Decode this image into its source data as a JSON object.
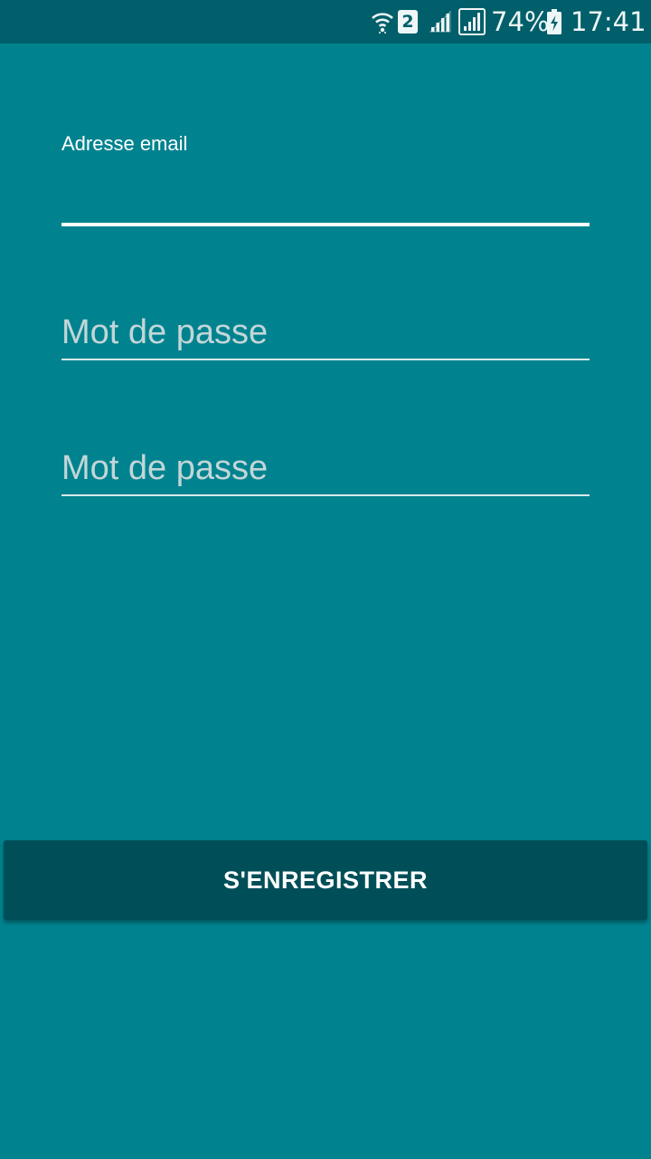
{
  "colors": {
    "background": "#00838f",
    "status_bar": "#005f6a",
    "button": "#004f58",
    "text": "#ffffff",
    "hint": "#c2d6d8"
  },
  "status_bar": {
    "icons": [
      "wifi-icon",
      "sim-2-icon",
      "signal-icon",
      "signal-icon",
      "battery-charging-icon"
    ],
    "sim_badge": "2",
    "battery": "74%",
    "time": "17:41"
  },
  "form": {
    "email": {
      "label": "Adresse email",
      "value": ""
    },
    "password": {
      "placeholder": "Mot de passe",
      "value": ""
    },
    "password_confirm": {
      "placeholder": "Mot de passe",
      "value": ""
    },
    "register_label": "S'ENREGISTRER"
  }
}
